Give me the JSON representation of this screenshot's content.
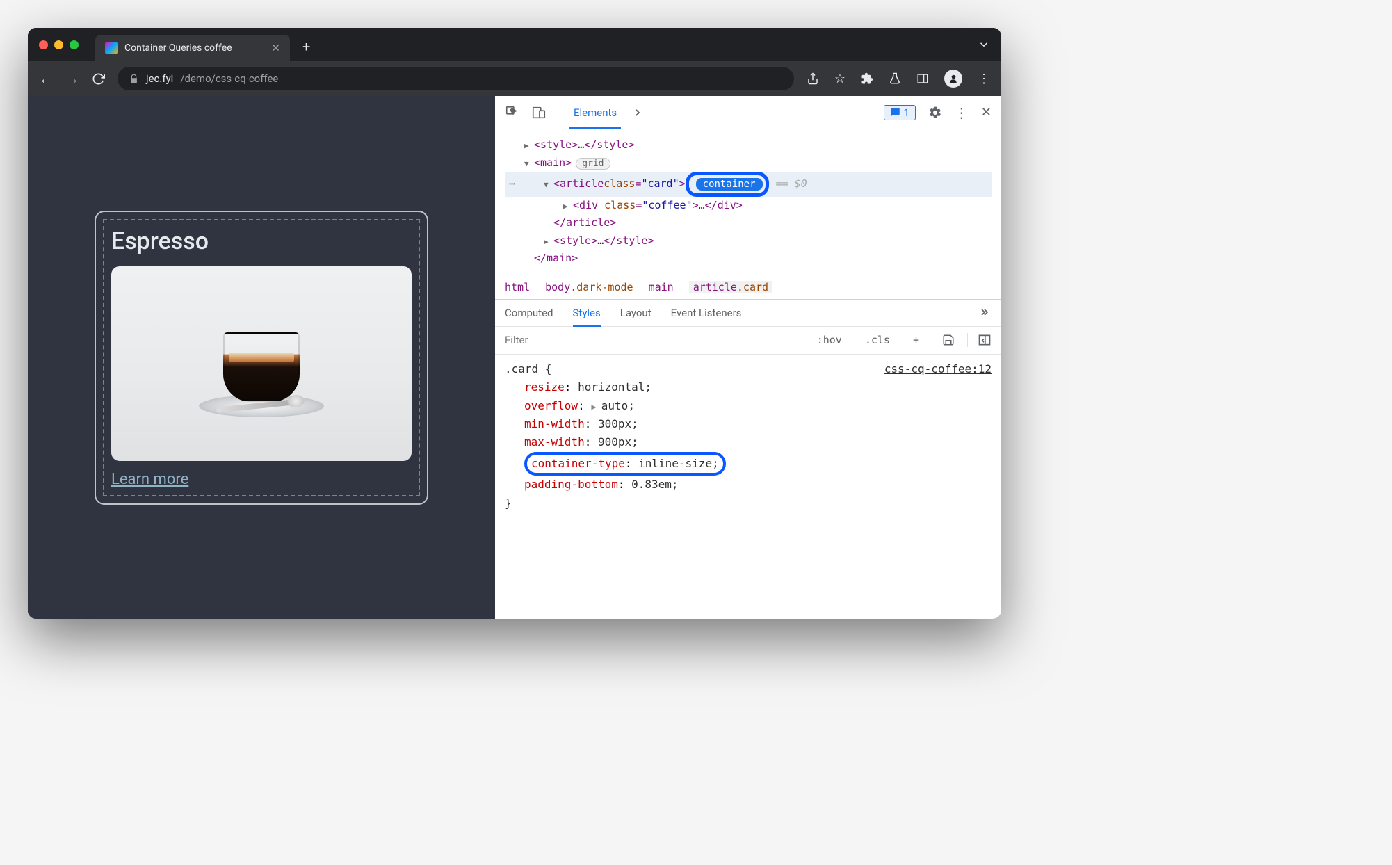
{
  "tab": {
    "title": "Container Queries coffee"
  },
  "url": {
    "domain": "jec.fyi",
    "path": "/demo/css-cq-coffee"
  },
  "page": {
    "card_title": "Espresso",
    "learn_more": "Learn more"
  },
  "devtools": {
    "main_tab": "Elements",
    "issues_count": "1",
    "dom": {
      "style_open": "<style>",
      "style_close": "</style>",
      "ellipsis": "…",
      "main_open": "<main>",
      "main_close": "</main>",
      "grid_badge": "grid",
      "article_open_tag": "article",
      "article_class_attr": "class",
      "article_class_val": "\"card\"",
      "container_badge": "container",
      "eq": "== $0",
      "div_open_tag": "div",
      "div_class_val": "\"coffee\"",
      "div_close": "</div>",
      "article_close": "</article>"
    },
    "crumbs": {
      "html": "html",
      "body": "body",
      "body_cls": ".dark-mode",
      "main": "main",
      "article": "article",
      "article_cls": ".card"
    },
    "styles_tabs": {
      "computed": "Computed",
      "styles": "Styles",
      "layout": "Layout",
      "el": "Event Listeners"
    },
    "filter": {
      "placeholder": "Filter",
      "hov": ":hov",
      "cls": ".cls"
    },
    "css": {
      "selector": ".card {",
      "source": "css-cq-coffee:12",
      "rules": [
        {
          "name": "resize",
          "value": "horizontal;"
        },
        {
          "name": "overflow",
          "value": "auto;",
          "expandable": true
        },
        {
          "name": "min-width",
          "value": "300px;"
        },
        {
          "name": "max-width",
          "value": "900px;"
        },
        {
          "name": "container-type",
          "value": "inline-size;",
          "highlight": true
        },
        {
          "name": "padding-bottom",
          "value": "0.83em;"
        }
      ],
      "close": "}"
    }
  }
}
